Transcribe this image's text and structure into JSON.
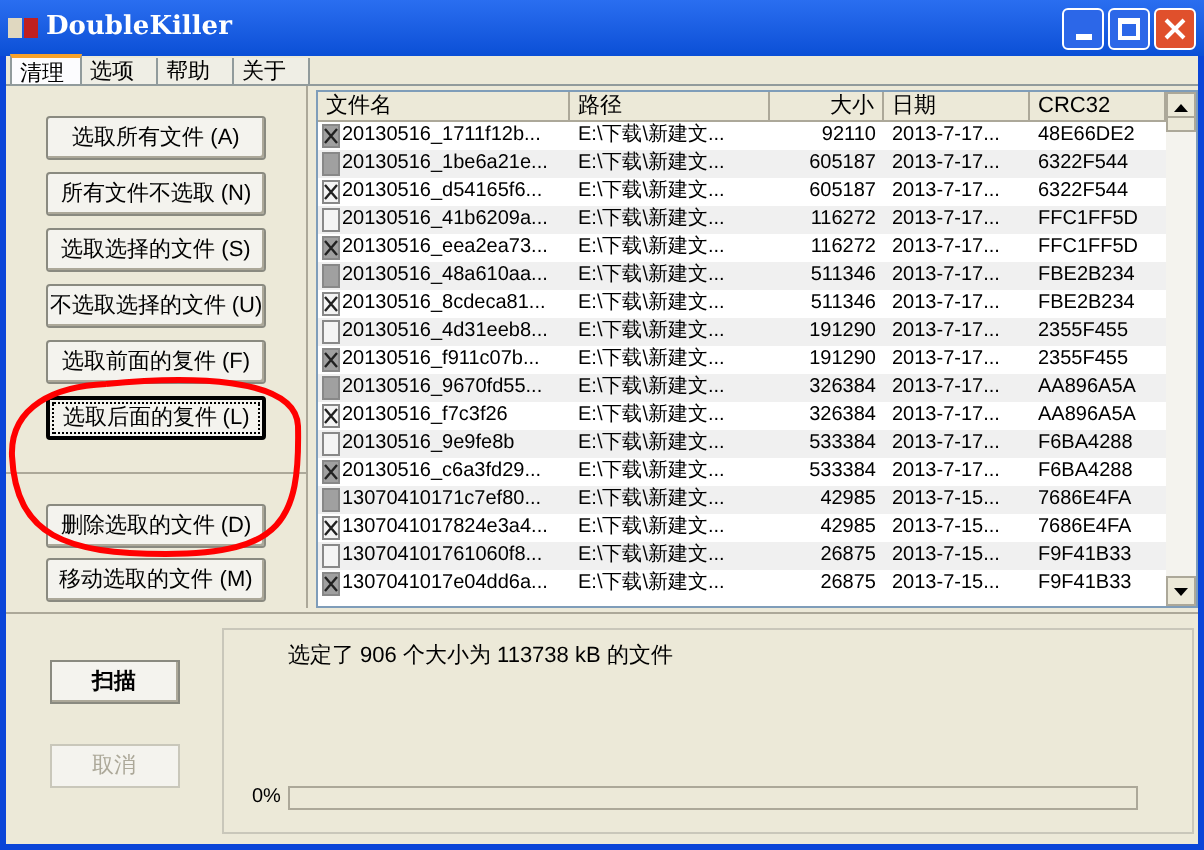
{
  "window": {
    "title": "DoubleKiller"
  },
  "tabs": [
    {
      "label": "清理",
      "selected": true
    },
    {
      "label": "选项",
      "selected": false
    },
    {
      "label": "帮助",
      "selected": false
    },
    {
      "label": "关于",
      "selected": false
    }
  ],
  "actions": [
    {
      "label": "选取所有文件 (A)",
      "focused": false
    },
    {
      "label": "所有文件不选取 (N)",
      "focused": false
    },
    {
      "label": "选取选择的文件 (S)",
      "focused": false
    },
    {
      "label": "不选取选择的文件 (U)",
      "focused": false
    },
    {
      "label": "选取前面的复件 (F)",
      "focused": false
    },
    {
      "label": "选取后面的复件 (L)",
      "focused": true
    }
  ],
  "file_actions": [
    {
      "label": "删除选取的文件 (D)"
    },
    {
      "label": "移动选取的文件 (M)"
    }
  ],
  "table": {
    "columns": [
      "文件名",
      "路径",
      "大小",
      "日期",
      "CRC32"
    ],
    "rows": [
      {
        "checked": true,
        "cells": [
          "20130516_1711f12b...",
          "E:\\下载\\新建文...",
          "92110",
          "2013-7-17...",
          "48E66DE2"
        ]
      },
      {
        "checked": false,
        "cells": [
          "20130516_1be6a21e...",
          "E:\\下载\\新建文...",
          "605187",
          "2013-7-17...",
          "6322F544"
        ]
      },
      {
        "checked": true,
        "cells": [
          "20130516_d54165f6...",
          "E:\\下载\\新建文...",
          "605187",
          "2013-7-17...",
          "6322F544"
        ]
      },
      {
        "checked": false,
        "cells": [
          "20130516_41b6209a...",
          "E:\\下载\\新建文...",
          "116272",
          "2013-7-17...",
          "FFC1FF5D"
        ]
      },
      {
        "checked": true,
        "cells": [
          "20130516_eea2ea73...",
          "E:\\下载\\新建文...",
          "116272",
          "2013-7-17...",
          "FFC1FF5D"
        ]
      },
      {
        "checked": false,
        "cells": [
          "20130516_48a610aa...",
          "E:\\下载\\新建文...",
          "511346",
          "2013-7-17...",
          "FBE2B234"
        ]
      },
      {
        "checked": true,
        "cells": [
          "20130516_8cdeca81...",
          "E:\\下载\\新建文...",
          "511346",
          "2013-7-17...",
          "FBE2B234"
        ]
      },
      {
        "checked": false,
        "cells": [
          "20130516_4d31eeb8...",
          "E:\\下载\\新建文...",
          "191290",
          "2013-7-17...",
          "2355F455"
        ]
      },
      {
        "checked": true,
        "cells": [
          "20130516_f911c07b...",
          "E:\\下载\\新建文...",
          "191290",
          "2013-7-17...",
          "2355F455"
        ]
      },
      {
        "checked": false,
        "cells": [
          "20130516_9670fd55...",
          "E:\\下载\\新建文...",
          "326384",
          "2013-7-17...",
          "AA896A5A"
        ]
      },
      {
        "checked": true,
        "cells": [
          "20130516_f7c3f26",
          "E:\\下载\\新建文...",
          "326384",
          "2013-7-17...",
          "AA896A5A"
        ]
      },
      {
        "checked": false,
        "cells": [
          "20130516_9e9fe8b",
          "E:\\下载\\新建文...",
          "533384",
          "2013-7-17...",
          "F6BA4288"
        ]
      },
      {
        "checked": true,
        "cells": [
          "20130516_c6a3fd29...",
          "E:\\下载\\新建文...",
          "533384",
          "2013-7-17...",
          "F6BA4288"
        ]
      },
      {
        "checked": false,
        "cells": [
          "13070410171c7ef80...",
          "E:\\下载\\新建文...",
          "42985",
          "2013-7-15...",
          "7686E4FA"
        ]
      },
      {
        "checked": true,
        "cells": [
          "1307041017824e3a4...",
          "E:\\下载\\新建文...",
          "42985",
          "2013-7-15...",
          "7686E4FA"
        ]
      },
      {
        "checked": false,
        "cells": [
          "130704101761060f8...",
          "E:\\下载\\新建文...",
          "26875",
          "2013-7-15...",
          "F9F41B33"
        ]
      },
      {
        "checked": true,
        "cells": [
          "1307041017e04dd6a...",
          "E:\\下载\\新建文...",
          "26875",
          "2013-7-15...",
          "F9F41B33"
        ]
      }
    ]
  },
  "scan_button": {
    "label": "扫描",
    "disabled": false
  },
  "cancel_button": {
    "label": "取消",
    "disabled": true
  },
  "status": "选定了 906 个大小为 113738 kB 的文件",
  "progress": {
    "label": "0%",
    "level": 0
  }
}
